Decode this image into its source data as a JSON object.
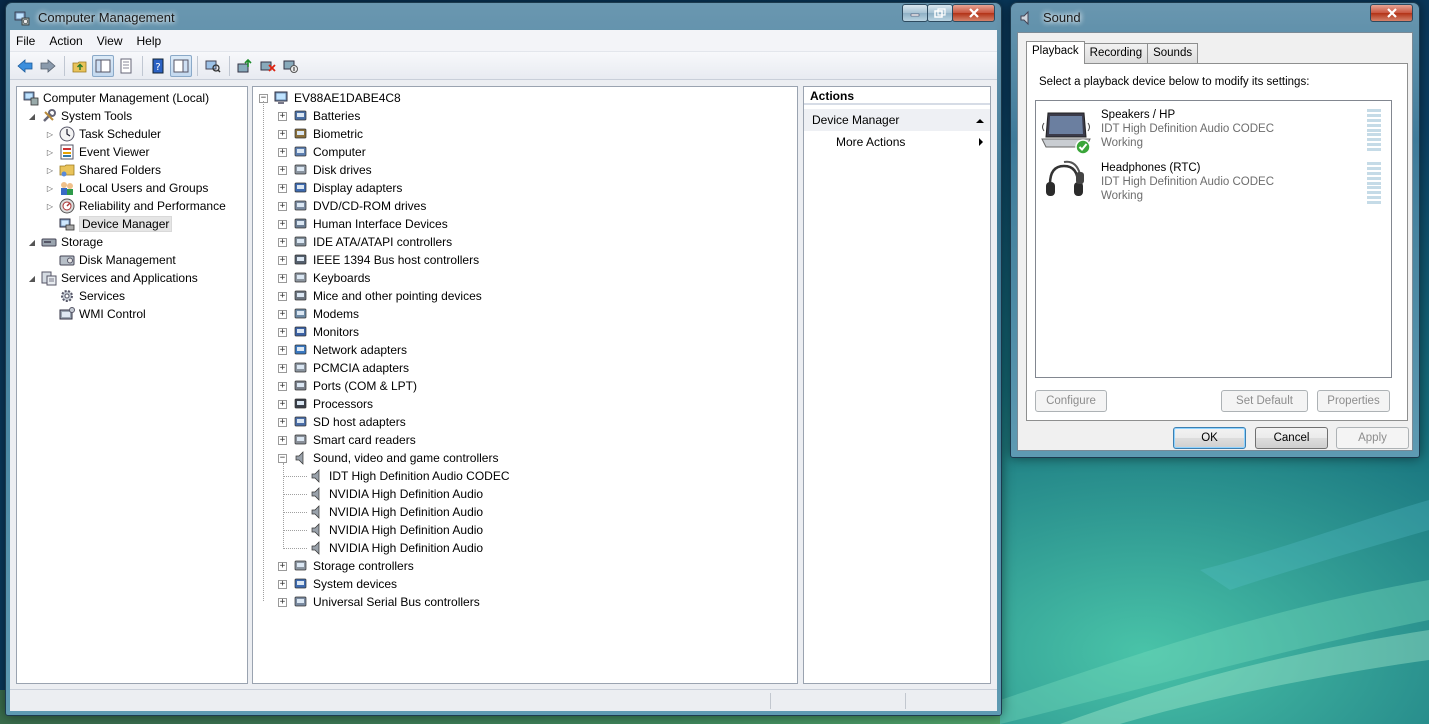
{
  "cm": {
    "title": "Computer Management",
    "menu": [
      "File",
      "Action",
      "View",
      "Help"
    ],
    "tree": {
      "root": "Computer Management (Local)",
      "system_tools": "System Tools",
      "system_tools_children": [
        "Task Scheduler",
        "Event Viewer",
        "Shared Folders",
        "Local Users and Groups",
        "Reliability and Performance",
        "Device Manager"
      ],
      "storage": "Storage",
      "storage_children": [
        "Disk Management"
      ],
      "services_apps": "Services and Applications",
      "services_apps_children": [
        "Services",
        "WMI Control"
      ]
    },
    "devices": {
      "computer": "EV88AE1DABE4C8",
      "categories": [
        "Batteries",
        "Biometric",
        "Computer",
        "Disk drives",
        "Display adapters",
        "DVD/CD-ROM drives",
        "Human Interface Devices",
        "IDE ATA/ATAPI controllers",
        "IEEE 1394 Bus host controllers",
        "Keyboards",
        "Mice and other pointing devices",
        "Modems",
        "Monitors",
        "Network adapters",
        "PCMCIA adapters",
        "Ports (COM & LPT)",
        "Processors",
        "SD host adapters",
        "Smart card readers",
        "Sound, video and game controllers"
      ],
      "sound_children": [
        "IDT High Definition Audio CODEC",
        "NVIDIA High Definition Audio",
        "NVIDIA High Definition Audio",
        "NVIDIA High Definition Audio",
        "NVIDIA High Definition Audio"
      ],
      "categories_after": [
        "Storage controllers",
        "System devices",
        "Universal Serial Bus controllers"
      ]
    },
    "actions": {
      "header": "Actions",
      "section": "Device Manager",
      "more": "More Actions"
    }
  },
  "sound": {
    "title": "Sound",
    "tabs": [
      "Playback",
      "Recording",
      "Sounds"
    ],
    "instruction": "Select a playback device below to modify its settings:",
    "devices": [
      {
        "name": "Speakers / HP",
        "driver": "IDT High Definition Audio CODEC",
        "status": "Working",
        "is_default": true
      },
      {
        "name": "Headphones (RTC)",
        "driver": "IDT High Definition Audio CODEC",
        "status": "Working",
        "is_default": false
      }
    ],
    "buttons": {
      "configure": "Configure",
      "set_default": "Set Default",
      "properties": "Properties",
      "ok": "OK",
      "cancel": "Cancel",
      "apply": "Apply"
    }
  }
}
